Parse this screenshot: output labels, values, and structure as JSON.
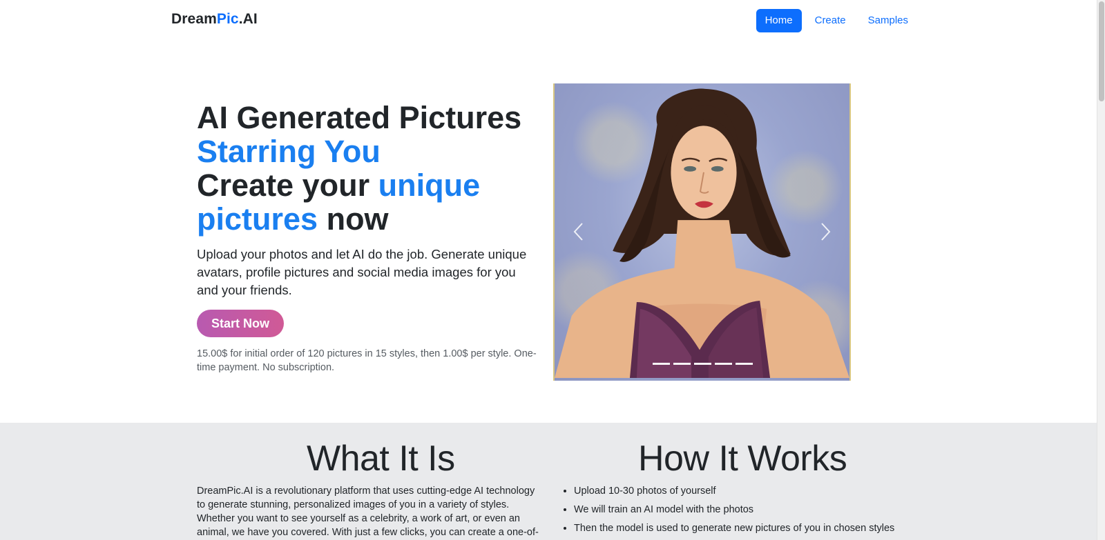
{
  "brand": {
    "part1": "Dream",
    "part2": "Pic",
    "part3": ".AI"
  },
  "nav": {
    "home": "Home",
    "create": "Create",
    "samples": "Samples"
  },
  "hero": {
    "line1": "AI Generated Pictures",
    "line2": "Starring You",
    "line3_a": "Create your",
    "line3_b": "unique",
    "line4_a": "pictures",
    "line4_b": "now",
    "lead": "Upload your photos and let AI do the job. Generate unique avatars, profile pictures and social media images for you and your friends.",
    "cta": "Start Now",
    "price_note": "15.00$ for initial order of 120 pictures in 15 styles, then 1.00$ per style. One-time payment. No subscription."
  },
  "carousel": {
    "slides": 5,
    "active_slide": 1
  },
  "what": {
    "title": "What It Is",
    "body": "DreamPic.AI is a revolutionary platform that uses cutting-edge AI technology to generate stunning, personalized images of you in a variety of styles. Whether you want to see yourself as a celebrity, a work of art, or even an animal, we have you covered. With just a few clicks, you can create a one-of-a-kind image that is sure"
  },
  "how": {
    "title": "How It Works",
    "steps": [
      "Upload 10-30 photos of yourself",
      "We will train an AI model with the photos",
      "Then the model is used to generate new pictures of you in chosen styles"
    ]
  },
  "colors": {
    "accent": "#0d6efd",
    "headline_blue": "#1a7ff0",
    "cta_start": "#b85ab0",
    "cta_end": "#d05a96",
    "section_bg": "#e9eaec"
  },
  "icons": {
    "prev": "chevron-left-icon",
    "next": "chevron-right-icon"
  }
}
